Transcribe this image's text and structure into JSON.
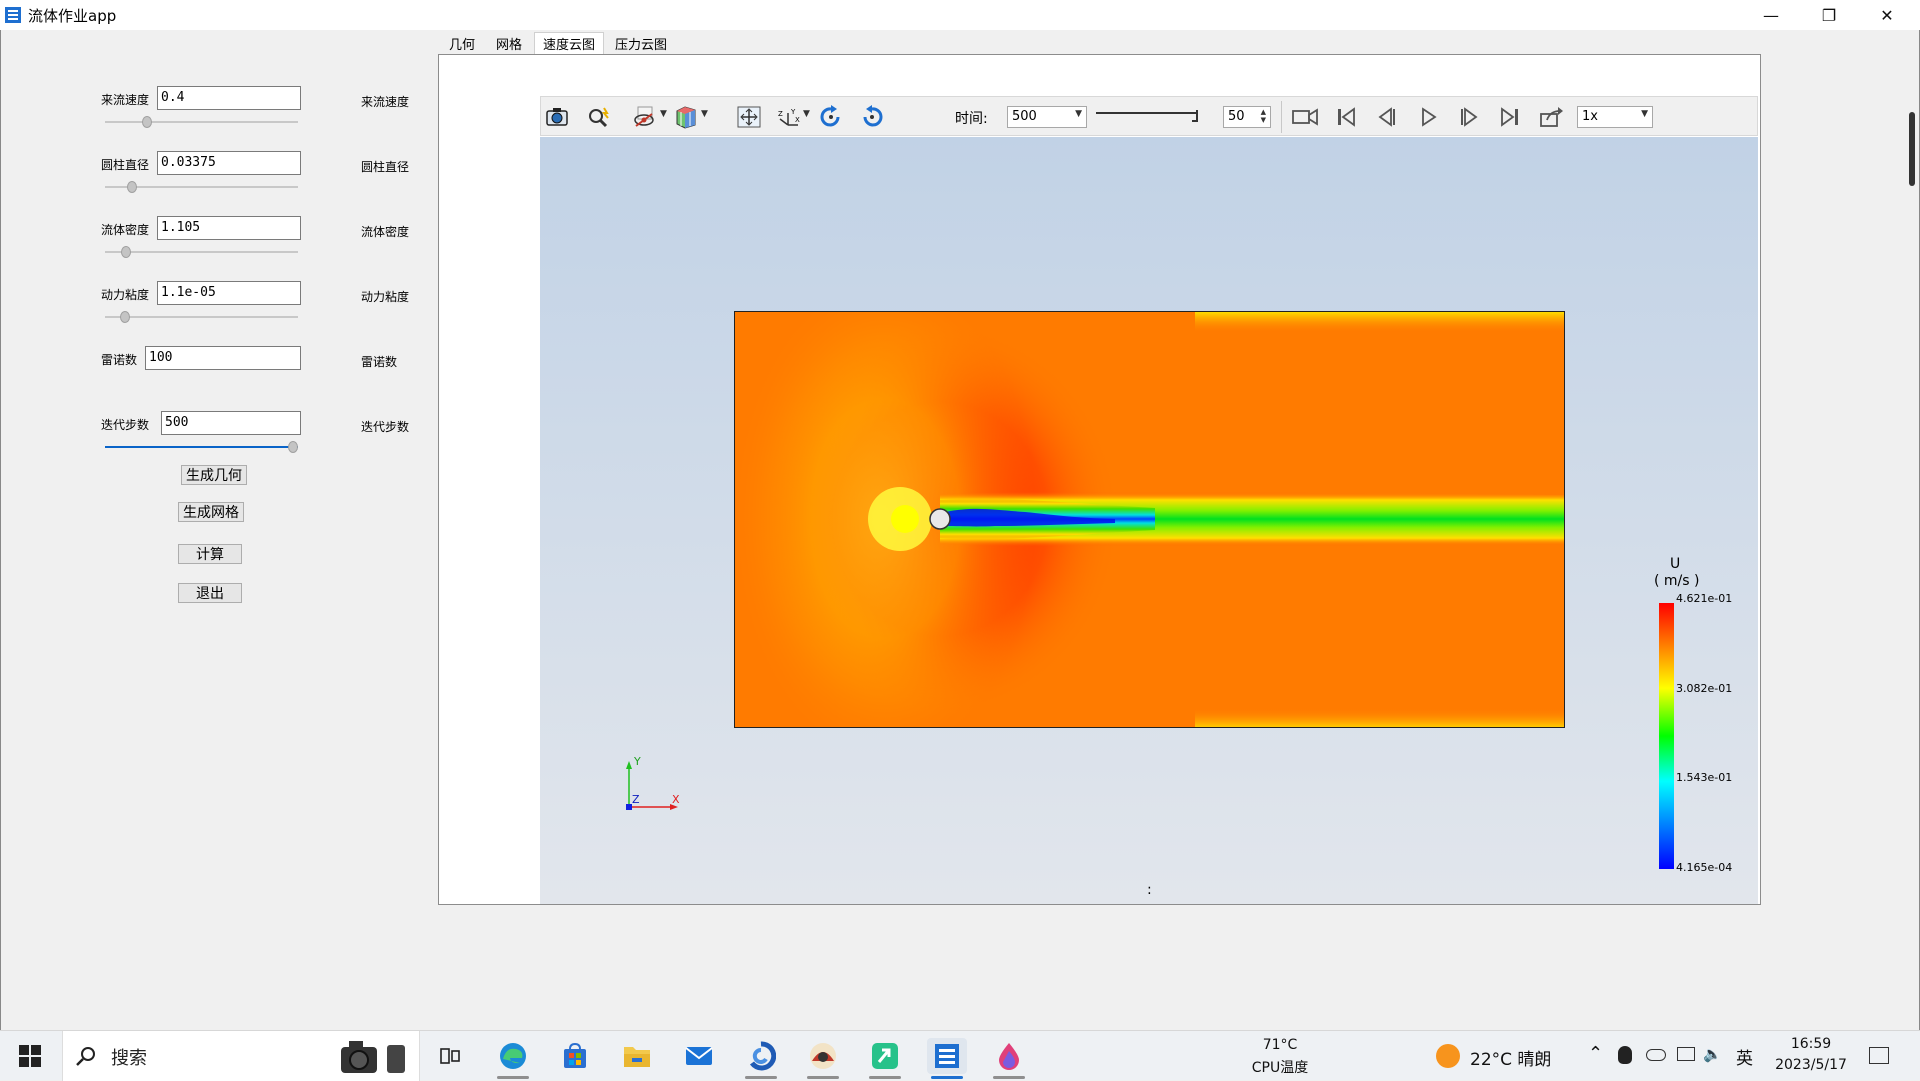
{
  "window": {
    "title": "流体作业app",
    "minimize": "—",
    "maximize": "❐",
    "close": "✕"
  },
  "params": [
    {
      "label": "来流速度",
      "value": "0.4",
      "side_label": "来流速度",
      "slider": 0.2
    },
    {
      "label": "圆柱直径",
      "value": "0.03375",
      "side_label": "圆柱直径",
      "slider": 0.12
    },
    {
      "label": "流体密度",
      "value": "1.105",
      "side_label": "流体密度",
      "slider": 0.09
    },
    {
      "label": "动力粘度",
      "value": "1.1e-05",
      "side_label": "动力粘度",
      "slider": 0.08
    },
    {
      "label": "雷诺数",
      "value": "100",
      "side_label": "雷诺数"
    },
    {
      "label": "迭代步数",
      "value": "500",
      "side_label": "迭代步数",
      "slider": 1.0
    }
  ],
  "buttons": {
    "gen_geometry": "生成几何",
    "gen_mesh": "生成网格",
    "compute": "计算",
    "exit": "退出"
  },
  "tabs": [
    {
      "label": "几何",
      "active": false
    },
    {
      "label": "网格",
      "active": false
    },
    {
      "label": "速度云图",
      "active": true
    },
    {
      "label": "压力云图",
      "active": false
    }
  ],
  "toolbar": {
    "time_label": "时间:",
    "time_value": "500",
    "frame_value": "50",
    "speed_value": "1x",
    "timeline_position": 1.0
  },
  "axes": {
    "y": "Y",
    "z": "Z",
    "x": "X"
  },
  "colorbar": {
    "title": "U",
    "unit": "( m/s )",
    "labels": [
      "4.621e-01",
      "3.082e-01",
      "1.543e-01",
      "4.165e-04"
    ],
    "colors": [
      "#ff0000",
      "#ffff00",
      "#00ff00",
      "#00ffff",
      "#0000ff"
    ]
  },
  "viewport_marker": ":",
  "taskbar": {
    "search_placeholder": "搜索",
    "cpu_temp": "71°C",
    "cpu_label": "CPU温度",
    "weather": "22°C  晴朗",
    "ime": "英",
    "time": "16:59",
    "date": "2023/5/17"
  }
}
